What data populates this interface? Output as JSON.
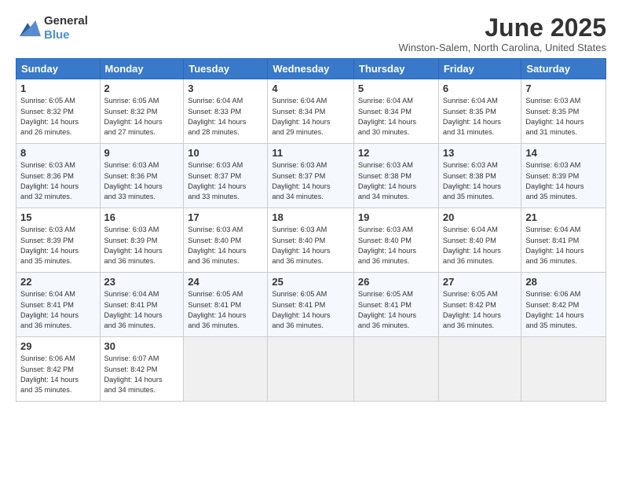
{
  "header": {
    "logo_general": "General",
    "logo_blue": "Blue",
    "title": "June 2025",
    "location": "Winston-Salem, North Carolina, United States"
  },
  "columns": [
    "Sunday",
    "Monday",
    "Tuesday",
    "Wednesday",
    "Thursday",
    "Friday",
    "Saturday"
  ],
  "weeks": [
    [
      {
        "day": "1",
        "info": "Sunrise: 6:05 AM\nSunset: 8:32 PM\nDaylight: 14 hours\nand 26 minutes."
      },
      {
        "day": "2",
        "info": "Sunrise: 6:05 AM\nSunset: 8:32 PM\nDaylight: 14 hours\nand 27 minutes."
      },
      {
        "day": "3",
        "info": "Sunrise: 6:04 AM\nSunset: 8:33 PM\nDaylight: 14 hours\nand 28 minutes."
      },
      {
        "day": "4",
        "info": "Sunrise: 6:04 AM\nSunset: 8:34 PM\nDaylight: 14 hours\nand 29 minutes."
      },
      {
        "day": "5",
        "info": "Sunrise: 6:04 AM\nSunset: 8:34 PM\nDaylight: 14 hours\nand 30 minutes."
      },
      {
        "day": "6",
        "info": "Sunrise: 6:04 AM\nSunset: 8:35 PM\nDaylight: 14 hours\nand 31 minutes."
      },
      {
        "day": "7",
        "info": "Sunrise: 6:03 AM\nSunset: 8:35 PM\nDaylight: 14 hours\nand 31 minutes."
      }
    ],
    [
      {
        "day": "8",
        "info": "Sunrise: 6:03 AM\nSunset: 8:36 PM\nDaylight: 14 hours\nand 32 minutes."
      },
      {
        "day": "9",
        "info": "Sunrise: 6:03 AM\nSunset: 8:36 PM\nDaylight: 14 hours\nand 33 minutes."
      },
      {
        "day": "10",
        "info": "Sunrise: 6:03 AM\nSunset: 8:37 PM\nDaylight: 14 hours\nand 33 minutes."
      },
      {
        "day": "11",
        "info": "Sunrise: 6:03 AM\nSunset: 8:37 PM\nDaylight: 14 hours\nand 34 minutes."
      },
      {
        "day": "12",
        "info": "Sunrise: 6:03 AM\nSunset: 8:38 PM\nDaylight: 14 hours\nand 34 minutes."
      },
      {
        "day": "13",
        "info": "Sunrise: 6:03 AM\nSunset: 8:38 PM\nDaylight: 14 hours\nand 35 minutes."
      },
      {
        "day": "14",
        "info": "Sunrise: 6:03 AM\nSunset: 8:39 PM\nDaylight: 14 hours\nand 35 minutes."
      }
    ],
    [
      {
        "day": "15",
        "info": "Sunrise: 6:03 AM\nSunset: 8:39 PM\nDaylight: 14 hours\nand 35 minutes."
      },
      {
        "day": "16",
        "info": "Sunrise: 6:03 AM\nSunset: 8:39 PM\nDaylight: 14 hours\nand 36 minutes."
      },
      {
        "day": "17",
        "info": "Sunrise: 6:03 AM\nSunset: 8:40 PM\nDaylight: 14 hours\nand 36 minutes."
      },
      {
        "day": "18",
        "info": "Sunrise: 6:03 AM\nSunset: 8:40 PM\nDaylight: 14 hours\nand 36 minutes."
      },
      {
        "day": "19",
        "info": "Sunrise: 6:03 AM\nSunset: 8:40 PM\nDaylight: 14 hours\nand 36 minutes."
      },
      {
        "day": "20",
        "info": "Sunrise: 6:04 AM\nSunset: 8:40 PM\nDaylight: 14 hours\nand 36 minutes."
      },
      {
        "day": "21",
        "info": "Sunrise: 6:04 AM\nSunset: 8:41 PM\nDaylight: 14 hours\nand 36 minutes."
      }
    ],
    [
      {
        "day": "22",
        "info": "Sunrise: 6:04 AM\nSunset: 8:41 PM\nDaylight: 14 hours\nand 36 minutes."
      },
      {
        "day": "23",
        "info": "Sunrise: 6:04 AM\nSunset: 8:41 PM\nDaylight: 14 hours\nand 36 minutes."
      },
      {
        "day": "24",
        "info": "Sunrise: 6:05 AM\nSunset: 8:41 PM\nDaylight: 14 hours\nand 36 minutes."
      },
      {
        "day": "25",
        "info": "Sunrise: 6:05 AM\nSunset: 8:41 PM\nDaylight: 14 hours\nand 36 minutes."
      },
      {
        "day": "26",
        "info": "Sunrise: 6:05 AM\nSunset: 8:41 PM\nDaylight: 14 hours\nand 36 minutes."
      },
      {
        "day": "27",
        "info": "Sunrise: 6:05 AM\nSunset: 8:42 PM\nDaylight: 14 hours\nand 36 minutes."
      },
      {
        "day": "28",
        "info": "Sunrise: 6:06 AM\nSunset: 8:42 PM\nDaylight: 14 hours\nand 35 minutes."
      }
    ],
    [
      {
        "day": "29",
        "info": "Sunrise: 6:06 AM\nSunset: 8:42 PM\nDaylight: 14 hours\nand 35 minutes."
      },
      {
        "day": "30",
        "info": "Sunrise: 6:07 AM\nSunset: 8:42 PM\nDaylight: 14 hours\nand 34 minutes."
      },
      {
        "day": "",
        "info": ""
      },
      {
        "day": "",
        "info": ""
      },
      {
        "day": "",
        "info": ""
      },
      {
        "day": "",
        "info": ""
      },
      {
        "day": "",
        "info": ""
      }
    ]
  ]
}
